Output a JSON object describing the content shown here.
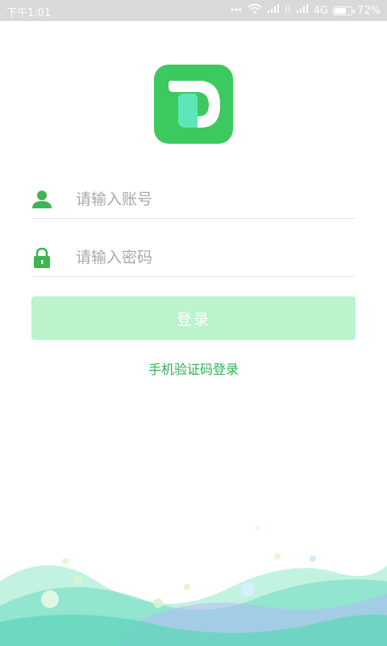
{
  "status_bar": {
    "time": "下午1:01",
    "network": "4G",
    "battery": "72%",
    "battery_level": 0.72
  },
  "app": {
    "logo_icon": "d-letter-logo-icon",
    "brand_color": "#3cc95f",
    "accent_light": "#bbf3cc"
  },
  "login_form": {
    "username": {
      "placeholder": "请输入账号",
      "value": "",
      "icon": "user-icon"
    },
    "password": {
      "placeholder": "请输入密码",
      "value": "",
      "icon": "lock-icon"
    },
    "login_label": "登录",
    "sms_login_label": "手机验证码登录"
  }
}
